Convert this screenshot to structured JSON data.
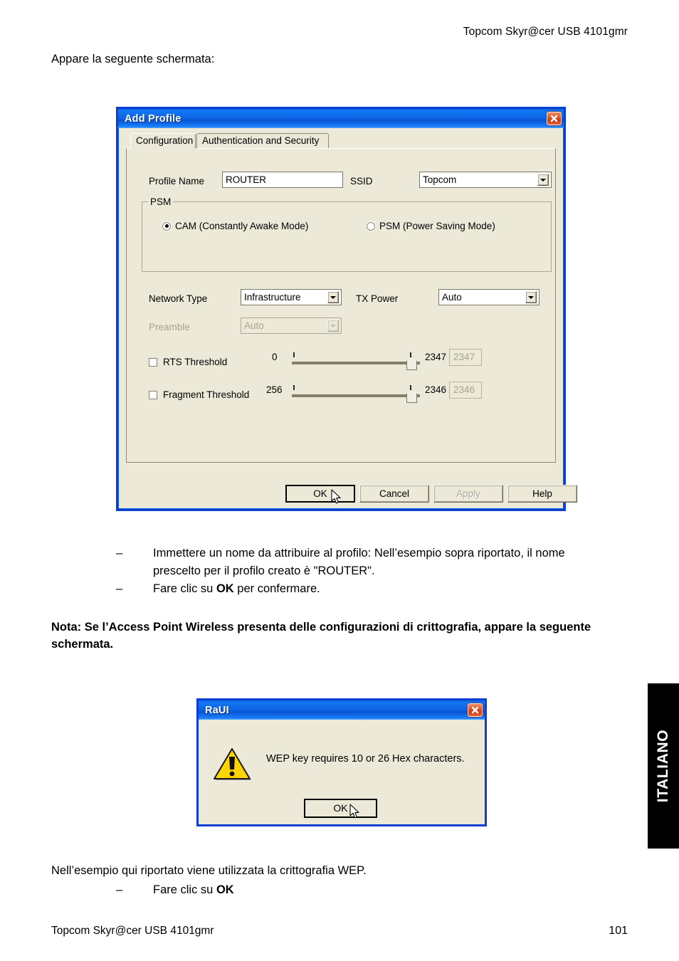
{
  "page": {
    "header_right": "Topcom Skyr@cer USB 4101gmr",
    "intro": "Appare la seguente schermata:",
    "bullets": [
      {
        "dash": "–",
        "text": "Immettere un nome da attribuire al profilo: Nell’esempio sopra riportato, il nome prescelto per il profilo creato è \"ROUTER\"."
      },
      {
        "dash": "–",
        "text_before": "Fare clic su ",
        "bold": "OK",
        "text_after": "  per confermare."
      }
    ],
    "note": "Nota:  Se l’Access Point Wireless presenta delle configurazioni di crittografia, appare la seguente schermata.",
    "closing_line": "Nell’esempio qui riportato viene utilizzata la crittografia WEP.",
    "closing_bullet": {
      "dash": "–",
      "text_before": "Fare clic su ",
      "bold": "OK"
    },
    "footer_left": "Topcom Skyr@cer USB 4101gmr",
    "footer_page": "101",
    "side_tab": "ITALIANO",
    "colors": {
      "titlebar_blue": "#0d63e3",
      "close_red": "#cf3a15",
      "sidetab_bg": "#000000",
      "dialog_face": "#ece9d8"
    }
  },
  "add_profile": {
    "title": "Add Profile",
    "close_icon": "close-icon",
    "tabs": [
      {
        "label": "Configuration",
        "active": true
      },
      {
        "label": "Authentication and Security",
        "active": false
      }
    ],
    "profile_name": {
      "label": "Profile Name",
      "value": "ROUTER"
    },
    "ssid": {
      "label": "SSID",
      "value": "Topcom"
    },
    "psm": {
      "legend": "PSM",
      "options": [
        {
          "label": "CAM (Constantly Awake Mode)",
          "checked": true
        },
        {
          "label": "PSM (Power Saving Mode)",
          "checked": false
        }
      ]
    },
    "network_type": {
      "label": "Network Type",
      "value": "Infrastructure"
    },
    "tx_power": {
      "label": "TX Power",
      "value": "Auto"
    },
    "preamble": {
      "label": "Preamble",
      "value": "Auto",
      "disabled": true
    },
    "rts_threshold": {
      "label": "RTS Threshold",
      "checked": false,
      "min": "0",
      "max": "2347",
      "value": "2347"
    },
    "fragment_threshold": {
      "label": "Fragment Threshold",
      "checked": false,
      "min": "256",
      "max": "2346",
      "value": "2346"
    },
    "buttons": [
      {
        "label": "OK",
        "default": true,
        "disabled": false
      },
      {
        "label": "Cancel",
        "default": false,
        "disabled": false
      },
      {
        "label": "Apply",
        "default": false,
        "disabled": true
      },
      {
        "label": "Help",
        "default": false,
        "disabled": false
      }
    ]
  },
  "raui": {
    "title": "RaUI",
    "close_icon": "close-icon",
    "icon": "warning-icon",
    "message": "WEP key requires 10 or 26 Hex characters.",
    "ok_label": "OK"
  }
}
